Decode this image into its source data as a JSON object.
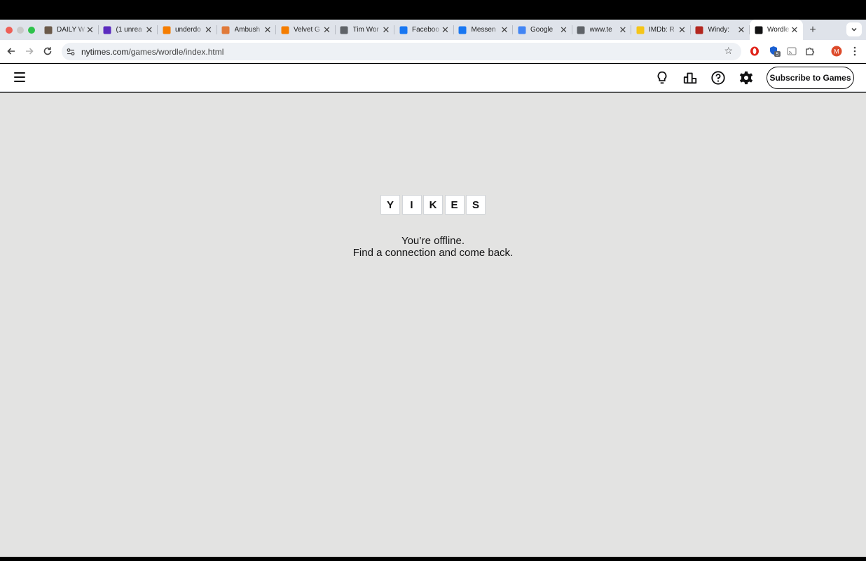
{
  "browser": {
    "tabs": [
      {
        "title": "DAILY W",
        "icon": "photo-favicon",
        "color": "#6b5a4a"
      },
      {
        "title": "(1 unrea",
        "icon": "mail-favicon",
        "color": "#5b2bbf"
      },
      {
        "title": "underdo",
        "icon": "blogger-favicon",
        "color": "#f57d00"
      },
      {
        "title": "Ambush",
        "icon": "circle-favicon",
        "color": "#e07a3a"
      },
      {
        "title": "Velvet G",
        "icon": "blogger-favicon",
        "color": "#f57d00"
      },
      {
        "title": "Tim Wor",
        "icon": "globe-favicon",
        "color": "#5f6368"
      },
      {
        "title": "Faceboo",
        "icon": "facebook-favicon",
        "color": "#1877f2"
      },
      {
        "title": "Messen",
        "icon": "facebook-favicon",
        "color": "#1877f2"
      },
      {
        "title": "Google",
        "icon": "calendar-favicon",
        "color": "#4285f4"
      },
      {
        "title": "www.te",
        "icon": "globe-favicon",
        "color": "#5f6368"
      },
      {
        "title": "IMDb: R",
        "icon": "imdb-favicon",
        "color": "#f5c518"
      },
      {
        "title": "Windy: ",
        "icon": "windy-favicon",
        "color": "#b3261e"
      },
      {
        "title": "Wordle",
        "icon": "wordle-favicon",
        "color": "#121213",
        "active": true
      }
    ],
    "close_glyph": "✕",
    "new_tab_glyph": "+",
    "url_host": "nytimes.com",
    "url_path": "/games/wordle/index.html",
    "extension_badge": "5",
    "profile_initial": "M"
  },
  "game": {
    "subscribe_label": "Subscribe to Games",
    "tiles": [
      "Y",
      "I",
      "K",
      "E",
      "S"
    ],
    "message_line1": "You’re offline.",
    "message_line2": "Find a connection and come back."
  },
  "colors": {
    "background": "#e3e3e2",
    "header": "#ffffff",
    "text": "#121213",
    "tile_border": "#d3d6da"
  }
}
